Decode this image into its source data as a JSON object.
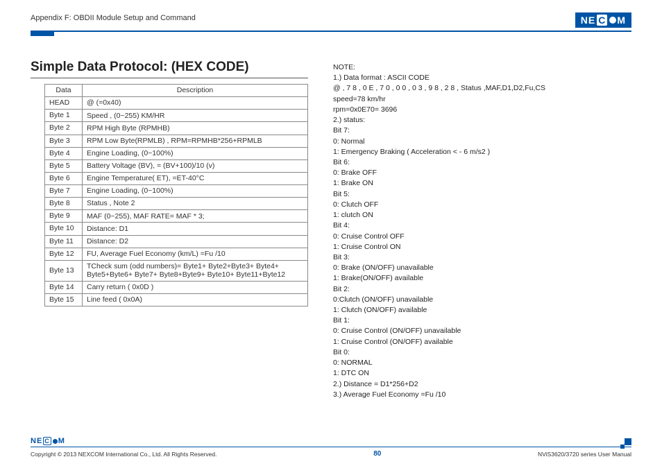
{
  "header": {
    "appendix": "Appendix F: OBDII Module Setup and Command",
    "logo_parts": [
      "NE",
      "C",
      "M"
    ]
  },
  "title": "Simple Data Protocol: (HEX CODE)",
  "table": {
    "headers": [
      "Data",
      "Description"
    ],
    "rows": [
      {
        "data": "HEAD",
        "desc": "@ (=0x40)"
      },
      {
        "data": "Byte 1",
        "desc": "Speed , (0~255) KM/HR"
      },
      {
        "data": "Byte 2",
        "desc": "RPM High Byte (RPMHB)"
      },
      {
        "data": "Byte 3",
        "desc": "RPM Low Byte(RPMLB) , RPM=RPMHB*256+RPMLB"
      },
      {
        "data": "Byte 4",
        "desc": "Engine Loading, (0~100%)"
      },
      {
        "data": "Byte 5",
        "desc": "Battery Voltage (BV), = (BV+100)/10 (v)"
      },
      {
        "data": "Byte 6",
        "desc": "Engine Temperature( ET), =ET-40°C"
      },
      {
        "data": "Byte 7",
        "desc": "Engine Loading, (0~100%)"
      },
      {
        "data": "Byte 8",
        "desc": "Status , Note 2"
      },
      {
        "data": "Byte 9",
        "desc": "MAF (0~255), MAF RATE= MAF * 3;"
      },
      {
        "data": "Byte 10",
        "desc": "Distance: D1"
      },
      {
        "data": "Byte 11",
        "desc": "Distance: D2"
      },
      {
        "data": "Byte 12",
        "desc": "FU, Average Fuel Economy (km/L) =Fu /10"
      },
      {
        "data": "Byte 13",
        "desc": "TCheck sum (odd numbers)= Byte1+ Byte2+Byte3+ Byte4+ Byte5+Byte6+ Byte7+ Byte8+Byte9+ Byte10+ Byte11+Byte12"
      },
      {
        "data": "Byte 14",
        "desc": "Carry return ( 0x0D )"
      },
      {
        "data": "Byte 15",
        "desc": "Line feed ( 0x0A)"
      }
    ]
  },
  "notes": [
    "NOTE:",
    "1.) Data format : ASCII CODE",
    "@ , 7 8 , 0 E , 7 0 , 0 0 , 0 3 , 9 8 , 2 8 , Status ,MAF,D1,D2,Fu,CS",
    "speed=78 km/hr",
    "rpm=0x0E70= 3696",
    "2.) status:",
    "Bit 7:",
    "0: Normal",
    "1: Emergency Braking ( Acceleration < - 6 m/s2 )",
    "Bit 6:",
    "0: Brake OFF",
    "1: Brake ON",
    "Bit 5:",
    "0: Clutch OFF",
    "1: clutch ON",
    "Bit 4:",
    "0: Cruise Control OFF",
    "1: Cruise Control ON",
    "Bit 3:",
    "0: Brake (ON/OFF) unavailable",
    "1: Brake(ON/OFF) available",
    "Bit 2:",
    "0:Clutch (ON/OFF) unavailable",
    "1: Clutch (ON/OFF) available",
    "Bit 1:",
    "0: Cruise Control (ON/OFF) unavailable",
    "1: Cruise Control (ON/OFF) available",
    "Bit 0:",
    "0: NORMAL",
    "1: DTC ON",
    "2.) Distance = D1*256+D2",
    "3.) Average Fuel Economy =Fu /10"
  ],
  "footer": {
    "copyright": "Copyright © 2013 NEXCOM International Co., Ltd. All Rights Reserved.",
    "page": "80",
    "manual": "NViS3620/3720 series User Manual"
  }
}
